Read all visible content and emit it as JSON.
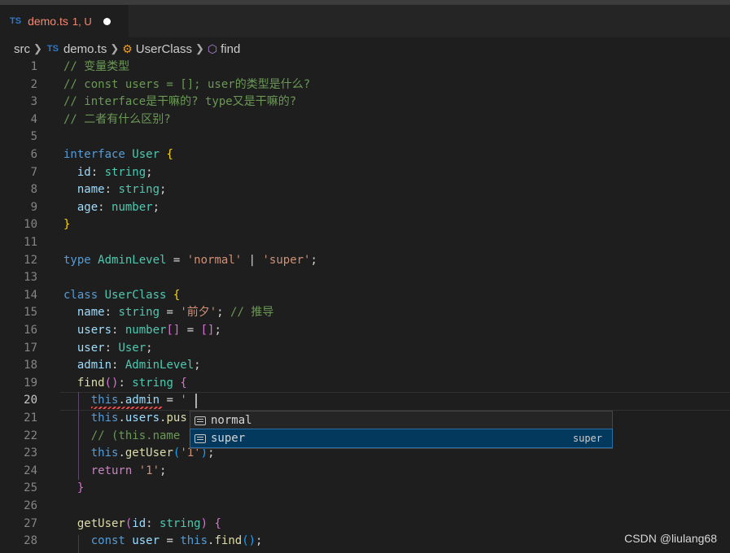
{
  "tab": {
    "lang": "TS",
    "name": "demo.ts",
    "status": "1, U"
  },
  "breadcrumb": [
    "src",
    "demo.ts",
    "UserClass",
    "find"
  ],
  "current_line": 20,
  "code": [
    [
      [
        "// 变量类型",
        "c"
      ]
    ],
    [
      [
        "// const users = []; user的类型是什么?",
        "c"
      ]
    ],
    [
      [
        "// interface是干嘛的? type又是干嘛的?",
        "c"
      ]
    ],
    [
      [
        "// 二者有什么区别?",
        "c"
      ]
    ],
    [],
    [
      [
        "interface ",
        "k"
      ],
      [
        "User ",
        "t"
      ],
      [
        "{",
        "y"
      ]
    ],
    [
      [
        "  id",
        "p"
      ],
      [
        ": ",
        "pl"
      ],
      [
        "string",
        "t"
      ],
      [
        ";",
        "pl"
      ]
    ],
    [
      [
        "  name",
        "p"
      ],
      [
        ": ",
        "pl"
      ],
      [
        "string",
        "t"
      ],
      [
        ";",
        "pl"
      ]
    ],
    [
      [
        "  age",
        "p"
      ],
      [
        ": ",
        "pl"
      ],
      [
        "number",
        "t"
      ],
      [
        ";",
        "pl"
      ]
    ],
    [
      [
        "}",
        "y"
      ]
    ],
    [],
    [
      [
        "type ",
        "k"
      ],
      [
        "AdminLevel",
        "t"
      ],
      [
        " = ",
        "pl"
      ],
      [
        "'normal'",
        "s"
      ],
      [
        " | ",
        "pl"
      ],
      [
        "'super'",
        "s"
      ],
      [
        ";",
        "pl"
      ]
    ],
    [],
    [
      [
        "class ",
        "k"
      ],
      [
        "UserClass ",
        "t"
      ],
      [
        "{",
        "y"
      ]
    ],
    [
      [
        "  name",
        "p"
      ],
      [
        ": ",
        "pl"
      ],
      [
        "string",
        "t"
      ],
      [
        " = ",
        "pl"
      ],
      [
        "'前夕'",
        "s"
      ],
      [
        "; ",
        "pl"
      ],
      [
        "// 推导",
        "c"
      ]
    ],
    [
      [
        "  users",
        "p"
      ],
      [
        ": ",
        "pl"
      ],
      [
        "number",
        "t"
      ],
      [
        "[]",
        "m"
      ],
      [
        " = ",
        "pl"
      ],
      [
        "[]",
        "m"
      ],
      [
        ";",
        "pl"
      ]
    ],
    [
      [
        "  user",
        "p"
      ],
      [
        ": ",
        "pl"
      ],
      [
        "User",
        "t"
      ],
      [
        ";",
        "pl"
      ]
    ],
    [
      [
        "  admin",
        "p"
      ],
      [
        ": ",
        "pl"
      ],
      [
        "AdminLevel",
        "t"
      ],
      [
        ";",
        "pl"
      ]
    ],
    [
      [
        "  find",
        "f"
      ],
      [
        "()",
        "m"
      ],
      [
        ": ",
        "pl"
      ],
      [
        "string ",
        "t"
      ],
      [
        "{",
        "m"
      ]
    ],
    [
      [
        "    this",
        "k"
      ],
      [
        ".",
        "pl"
      ],
      [
        "admin",
        "p"
      ],
      [
        " = ",
        "pl"
      ],
      [
        "'",
        "s"
      ]
    ],
    [
      [
        "    this",
        "k"
      ],
      [
        ".",
        "pl"
      ],
      [
        "users",
        "p"
      ],
      [
        ".",
        "pl"
      ],
      [
        "pus",
        "f"
      ]
    ],
    [
      [
        "    // (this.name",
        "c"
      ]
    ],
    [
      [
        "    this",
        "k"
      ],
      [
        ".",
        "pl"
      ],
      [
        "getUser",
        "f"
      ],
      [
        "(",
        "b"
      ],
      [
        "'1'",
        "s"
      ],
      [
        ")",
        "b"
      ],
      [
        ";",
        "pl"
      ]
    ],
    [
      [
        "    return ",
        "ctl"
      ],
      [
        "'1'",
        "s"
      ],
      [
        ";",
        "pl"
      ]
    ],
    [
      [
        "  }",
        "m"
      ]
    ],
    [],
    [
      [
        "  getUser",
        "f"
      ],
      [
        "(",
        "m"
      ],
      [
        "id",
        "p"
      ],
      [
        ": ",
        "pl"
      ],
      [
        "string",
        "t"
      ],
      [
        ")",
        "m"
      ],
      [
        " {",
        "m"
      ]
    ],
    [
      [
        "    const ",
        "k"
      ],
      [
        "user",
        "p"
      ],
      [
        " = ",
        "pl"
      ],
      [
        "this",
        "k"
      ],
      [
        ".",
        "pl"
      ],
      [
        "find",
        "f"
      ],
      [
        "()",
        "b"
      ],
      [
        ";",
        "pl"
      ]
    ]
  ],
  "suggestions": [
    {
      "label": "normal",
      "detail": ""
    },
    {
      "label": "super",
      "detail": "super",
      "selected": true
    }
  ],
  "watermark": "CSDN @liulang68"
}
